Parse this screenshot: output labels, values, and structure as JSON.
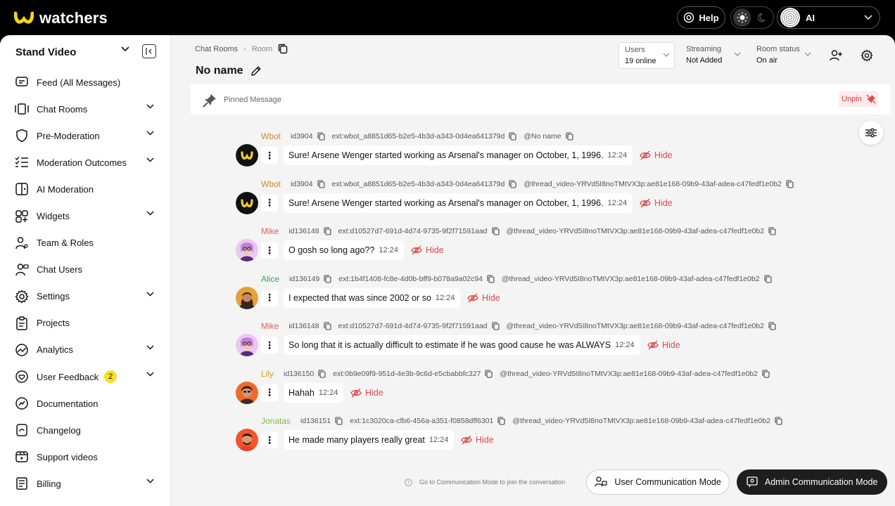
{
  "brand": {
    "name": "watchers"
  },
  "topbar": {
    "help_label": "Help",
    "user_name": "AI"
  },
  "sidebar": {
    "project": "Stand Video",
    "items": [
      {
        "label": "Feed (All Messages)",
        "icon": "feed-icon",
        "expandable": false
      },
      {
        "label": "Chat Rooms",
        "icon": "chat-rooms-icon",
        "expandable": true
      },
      {
        "label": "Pre-Moderation",
        "icon": "shield-icon",
        "expandable": true
      },
      {
        "label": "Moderation Outcomes",
        "icon": "checklist-icon",
        "expandable": true
      },
      {
        "label": "AI Moderation",
        "icon": "ai-moderation-icon",
        "expandable": false
      },
      {
        "label": "Widgets",
        "icon": "widgets-icon",
        "expandable": true
      },
      {
        "label": "Team & Roles",
        "icon": "team-icon",
        "expandable": false
      },
      {
        "label": "Chat Users",
        "icon": "chat-users-icon",
        "expandable": false
      },
      {
        "label": "Settings",
        "icon": "gear-icon",
        "expandable": true
      },
      {
        "label": "Projects",
        "icon": "projects-icon",
        "expandable": false
      },
      {
        "label": "Analytics",
        "icon": "analytics-icon",
        "expandable": true
      },
      {
        "label": "User Feedback",
        "icon": "heart-chat-icon",
        "expandable": true,
        "badge": "2"
      },
      {
        "label": "Documentation",
        "icon": "documentation-icon",
        "expandable": false
      },
      {
        "label": "Changelog",
        "icon": "changelog-icon",
        "expandable": false
      },
      {
        "label": "Support videos",
        "icon": "video-icon",
        "expandable": false
      },
      {
        "label": "Billing",
        "icon": "billing-icon",
        "expandable": true
      }
    ]
  },
  "breadcrumb": {
    "parent": "Chat Rooms",
    "current": "Room"
  },
  "room": {
    "title": "No name"
  },
  "filters": {
    "users": {
      "label": "Users",
      "value": "19 online"
    },
    "streaming": {
      "label": "Streaming",
      "value": "Not Added"
    },
    "room_status": {
      "label": "Room status",
      "value": "On air"
    }
  },
  "pinned": {
    "label": "Pinned Message",
    "unpin_label": "Unpin"
  },
  "messages": [
    {
      "name": "Wbot",
      "name_color": "#d9822b",
      "id": "id3904",
      "ext": "ext:wbot_a8851d65-b2e5-4b3d-a343-0d4ea641379d",
      "thread": "@No name",
      "text": "Sure! Arsene Wenger started working as Arsenal's manager on October, 1, 1996.",
      "time": "12:24",
      "hide_label": "Hide",
      "avatar": "wbot"
    },
    {
      "name": "Wbot",
      "name_color": "#d9822b",
      "id": "id3904",
      "ext": "ext:wbot_a8851d65-b2e5-4b3d-a343-0d4ea641379d",
      "thread": "@thread_video-YRVd5I8noTMtVX3p:ae81e168-09b9-43af-adea-c47fedf1e0b2",
      "text": "Sure! Arsene Wenger started working as Arsenal's manager on October, 1, 1996.",
      "time": "12:24",
      "hide_label": "Hide",
      "avatar": "wbot"
    },
    {
      "name": "Mike",
      "name_color": "#e0605a",
      "id": "id136148",
      "ext": "ext:d10527d7-691d-4d74-9735-9f2f71591aad",
      "thread": "@thread_video-YRVd5I8noTMtVX3p:ae81e168-09b9-43af-adea-c47fedf1e0b2",
      "text": "O gosh so long ago??",
      "time": "12:24",
      "hide_label": "Hide",
      "avatar": "mike"
    },
    {
      "name": "Alice",
      "name_color": "#2faa4a",
      "id": "id136149",
      "ext": "ext:1b4f1408-fc8e-4d0b-bff9-b078a9a02c94",
      "thread": "@thread_video-YRVd5I8noTMtVX3p:ae81e168-09b9-43af-adea-c47fedf1e0b2",
      "text": "I expected that was since 2002 or so",
      "time": "12:24",
      "hide_label": "Hide",
      "avatar": "alice"
    },
    {
      "name": "Mike",
      "name_color": "#e0605a",
      "id": "id136148",
      "ext": "ext:d10527d7-691d-4d74-9735-9f2f71591aad",
      "thread": "@thread_video-YRVd5I8noTMtVX3p:ae81e168-09b9-43af-adea-c47fedf1e0b2",
      "text": "So long that it is actually difficult to estimate if he was good cause he was ALWAYS",
      "time": "12:24",
      "hide_label": "Hide",
      "avatar": "mike"
    },
    {
      "name": "Lily",
      "name_color": "#c9a21a",
      "id": "id136150",
      "ext": "ext:0b9e09f9-951d-4e3b-9c6d-e5cbabbfc327",
      "thread": "@thread_video-YRVd5I8noTMtVX3p:ae81e168-09b9-43af-adea-c47fedf1e0b2",
      "text": "Hahah",
      "time": "12:24",
      "hide_label": "Hide",
      "avatar": "lily"
    },
    {
      "name": "Jonatas",
      "name_color": "#7bbf3a",
      "id": "id136151",
      "ext": "ext:1c3020ca-cfb6-456a-a351-f0858dff6301",
      "thread": "@thread_video-YRVd5I8noTMtVX3p:ae81e168-09b9-43af-adea-c47fedf1e0b2",
      "text": "He made many players really great",
      "time": "12:24",
      "hide_label": "Hide",
      "avatar": "jonatas"
    }
  ],
  "footer": {
    "hint": "Go to Communication Mode to join the conversation",
    "user_mode_label": "User Communication Mode",
    "admin_mode_label": "Admin Communication Mode"
  }
}
